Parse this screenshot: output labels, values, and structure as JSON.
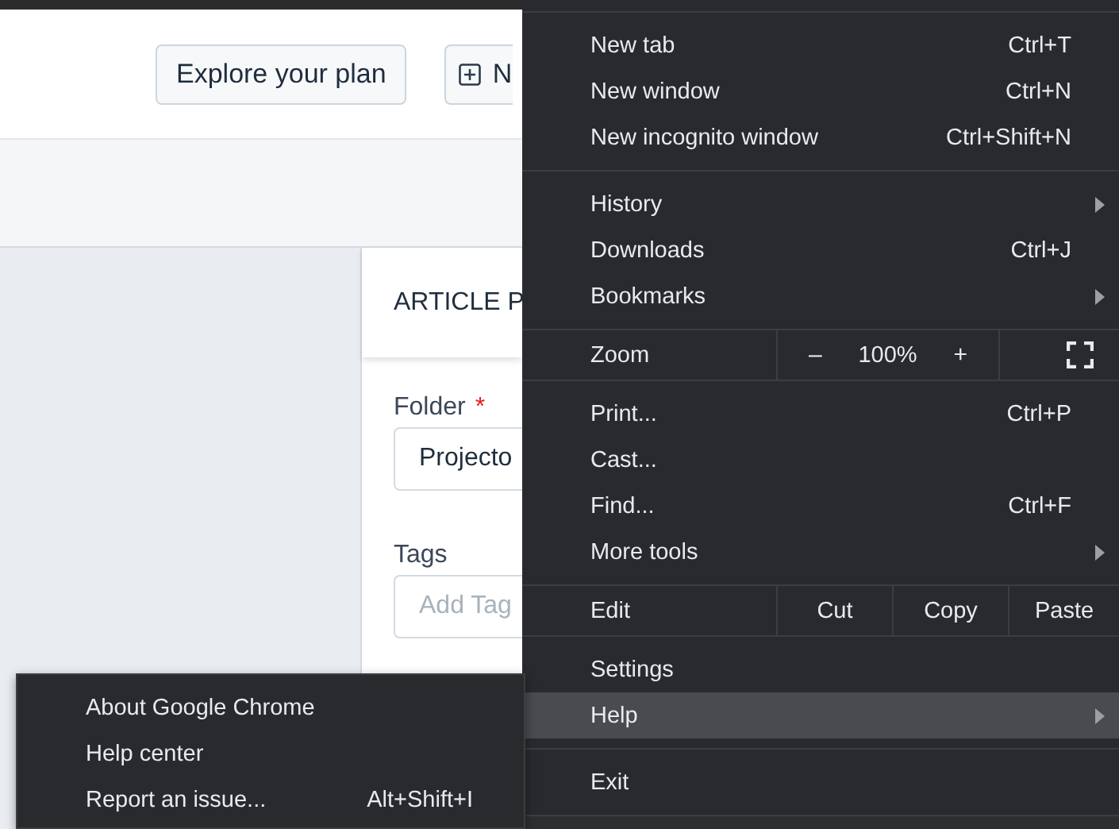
{
  "page": {
    "header_buttons": [
      {
        "label": "Explore your plan",
        "kind": "plain"
      },
      {
        "label": "N",
        "kind": "add"
      }
    ],
    "panel": {
      "title": "ARTICLE P",
      "fields": [
        {
          "label": "Folder",
          "required_mark": "*",
          "value": "Projecto"
        },
        {
          "label": "Tags",
          "placeholder": "Add Tag"
        }
      ]
    }
  },
  "menu": {
    "sections": [
      {
        "items": [
          {
            "kind": "item",
            "label": "New tab",
            "shortcut": "Ctrl+T",
            "submenu": false,
            "selected": false
          },
          {
            "kind": "item",
            "label": "New window",
            "shortcut": "Ctrl+N",
            "submenu": false,
            "selected": false
          },
          {
            "kind": "item",
            "label": "New incognito window",
            "shortcut": "Ctrl+Shift+N",
            "submenu": false,
            "selected": false
          }
        ]
      },
      {
        "items": [
          {
            "kind": "item",
            "label": "History",
            "submenu": true,
            "selected": false
          },
          {
            "kind": "item",
            "label": "Downloads",
            "shortcut": "Ctrl+J",
            "submenu": false,
            "selected": false
          },
          {
            "kind": "item",
            "label": "Bookmarks",
            "submenu": true,
            "selected": false
          }
        ]
      },
      {
        "items": [
          {
            "kind": "zoom",
            "label": "Zoom",
            "minus": "–",
            "value": "100%",
            "plus": "+"
          }
        ]
      },
      {
        "items": [
          {
            "kind": "item",
            "label": "Print...",
            "shortcut": "Ctrl+P",
            "submenu": false,
            "selected": false
          },
          {
            "kind": "item",
            "label": "Cast...",
            "submenu": false,
            "selected": false
          },
          {
            "kind": "item",
            "label": "Find...",
            "shortcut": "Ctrl+F",
            "submenu": false,
            "selected": false
          },
          {
            "kind": "item",
            "label": "More tools",
            "submenu": true,
            "selected": false
          }
        ]
      },
      {
        "items": [
          {
            "kind": "edit",
            "label": "Edit",
            "buttons": [
              "Cut",
              "Copy",
              "Paste"
            ]
          }
        ]
      },
      {
        "items": [
          {
            "kind": "item",
            "label": "Settings",
            "submenu": false,
            "selected": false
          },
          {
            "kind": "item",
            "label": "Help",
            "submenu": true,
            "selected": true
          }
        ]
      },
      {
        "items": [
          {
            "kind": "item",
            "label": "Exit",
            "submenu": false,
            "selected": false
          }
        ]
      }
    ]
  },
  "submenu": {
    "items": [
      {
        "label": "About Google Chrome"
      },
      {
        "label": "Help center"
      },
      {
        "label": "Report an issue...",
        "shortcut": "Alt+Shift+I"
      }
    ]
  }
}
